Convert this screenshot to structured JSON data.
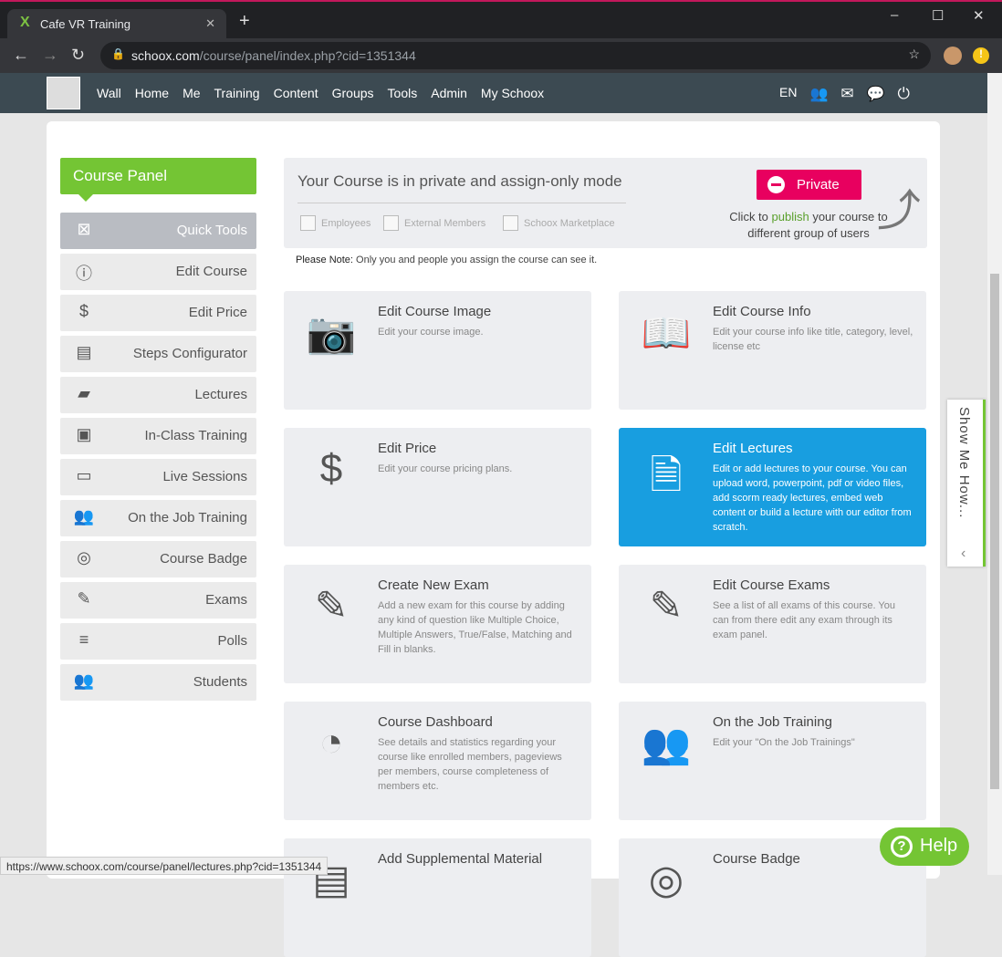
{
  "browser": {
    "tab_title": "Cafe VR Training",
    "url_domain": "schoox.com",
    "url_path": "/course/panel/index.php?cid=1351344",
    "status_url": "https://www.schoox.com/course/panel/lectures.php?cid=1351344"
  },
  "nav": {
    "items": [
      "Wall",
      "Home",
      "Me",
      "Training",
      "Content",
      "Groups",
      "Tools",
      "Admin",
      "My Schoox"
    ],
    "lang": "EN"
  },
  "sidebar": {
    "title": "Course Panel",
    "items": [
      {
        "label": "Quick Tools",
        "icon": "quick-tools-icon",
        "glyph": "⊠"
      },
      {
        "label": "Edit Course",
        "icon": "info-icon",
        "glyph": "ⓘ"
      },
      {
        "label": "Edit Price",
        "icon": "price-icon",
        "glyph": "$"
      },
      {
        "label": "Steps Configurator",
        "icon": "steps-icon",
        "glyph": "▤"
      },
      {
        "label": "Lectures",
        "icon": "folder-icon",
        "glyph": "▰"
      },
      {
        "label": "In-Class Training",
        "icon": "classroom-icon",
        "glyph": "▣"
      },
      {
        "label": "Live Sessions",
        "icon": "live-icon",
        "glyph": "▭"
      },
      {
        "label": "On the Job Training",
        "icon": "users-icon",
        "glyph": "👥"
      },
      {
        "label": "Course Badge",
        "icon": "badge-icon",
        "glyph": "◎"
      },
      {
        "label": "Exams",
        "icon": "exam-icon",
        "glyph": "✎"
      },
      {
        "label": "Polls",
        "icon": "polls-icon",
        "glyph": "≡"
      },
      {
        "label": "Students",
        "icon": "students-icon",
        "glyph": "👥"
      }
    ]
  },
  "status": {
    "title": "Your Course is in private and assign-only mode",
    "checks": [
      "Employees",
      "External Members",
      "Schoox Marketplace"
    ],
    "private_label": "Private",
    "hint_pre": "Click to ",
    "hint_link": "publish",
    "hint_post": " your course to different group of users",
    "note_label": "Please Note:",
    "note_text": " Only you and people you assign the course can see it."
  },
  "tiles": [
    {
      "title": "Edit Course Image",
      "desc": "Edit your course image.",
      "icon": "camera-gear-icon",
      "glyph": "📷"
    },
    {
      "title": "Edit Course Info",
      "desc": "Edit your course info like title, category, level, license etc",
      "icon": "book-gear-icon",
      "glyph": "📖"
    },
    {
      "title": "Edit Price",
      "desc": "Edit your course pricing plans.",
      "icon": "price-book-icon",
      "glyph": "$"
    },
    {
      "title": "Edit Lectures",
      "desc": "Edit or add lectures to your course. You can upload word, powerpoint, pdf or video files, add scorm ready lectures, embed web content or build a lecture with our editor from scratch.",
      "icon": "documents-gear-icon",
      "glyph": "🗎"
    },
    {
      "title": "Create New Exam",
      "desc": "Add a new exam for this course by adding any kind of question like Multiple Choice, Multiple Answers, True/False, Matching and Fill in blanks.",
      "icon": "exam-add-icon",
      "glyph": "✎"
    },
    {
      "title": "Edit Course Exams",
      "desc": "See a list of all exams of this course. You can from there edit any exam through its exam panel.",
      "icon": "exam-gear-icon",
      "glyph": "✎"
    },
    {
      "title": "Course Dashboard",
      "desc": "See details and statistics regarding your course like enrolled members, pageviews per members, course completeness of members etc.",
      "icon": "pie-chart-icon",
      "glyph": "◔"
    },
    {
      "title": "On the Job Training",
      "desc": "Edit your \"On the Job Trainings\"",
      "icon": "users-icon",
      "glyph": "👥"
    },
    {
      "title": "Add Supplemental Material",
      "desc": "",
      "icon": "material-icon",
      "glyph": "▤"
    },
    {
      "title": "Course Badge",
      "desc": "",
      "icon": "badge-icon",
      "glyph": "◎"
    }
  ],
  "showme": "Show Me How...",
  "help": "Help"
}
